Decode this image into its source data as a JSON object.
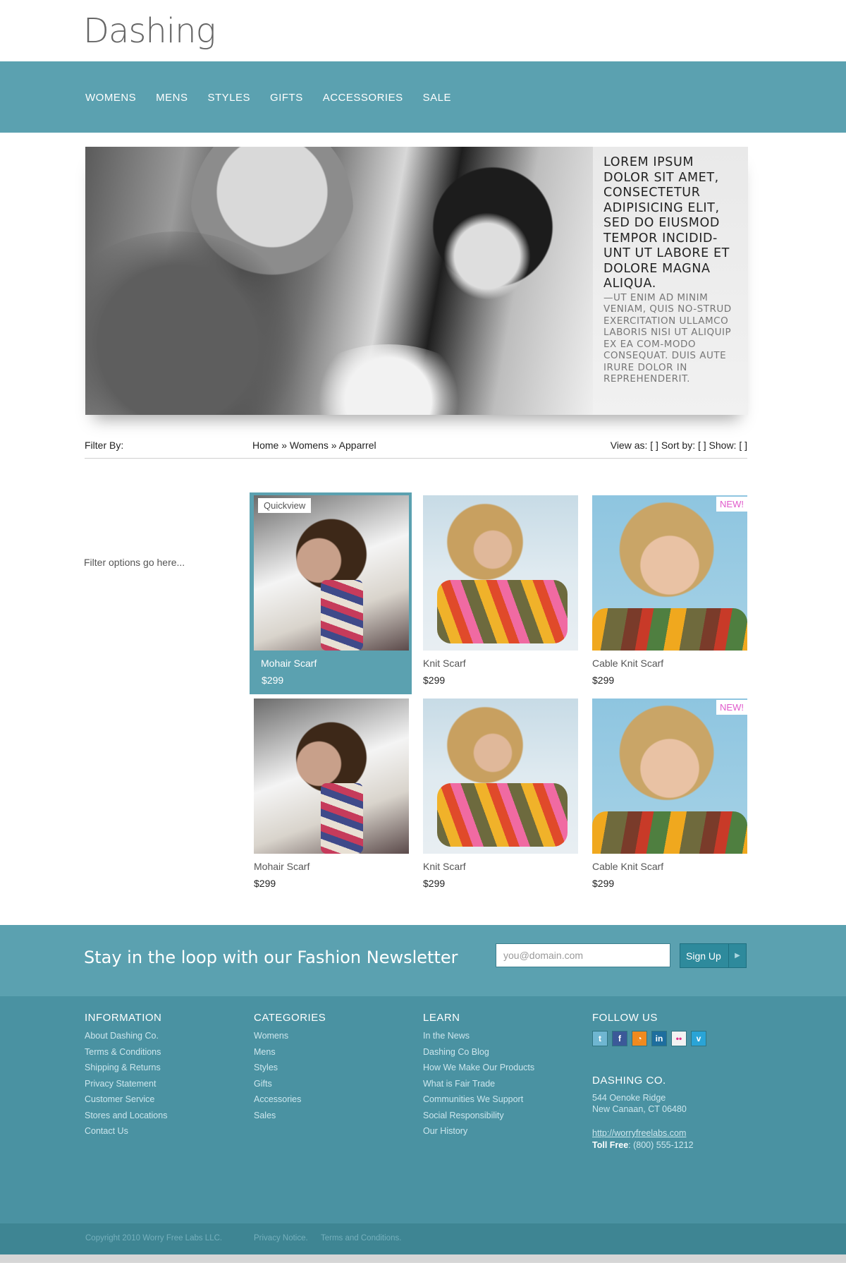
{
  "brand": {
    "logo": "Dashing"
  },
  "nav": {
    "items": [
      {
        "label": "WOMENS"
      },
      {
        "label": "MENS"
      },
      {
        "label": "STYLES"
      },
      {
        "label": "GIFTS"
      },
      {
        "label": "ACCESSORIES"
      },
      {
        "label": "SALE"
      }
    ]
  },
  "hero": {
    "headline": "LOREM IPSUM DOLOR SIT AMET, CONSECTETUR ADIPISICING ELIT, SED DO EIUSMOD TEMPOR INCIDID-UNT UT LABORE ET DOLORE MAGNA ALIQUA.",
    "body": "—UT ENIM AD MINIM VENIAM, QUIS NO-STRUD EXERCITATION ULLAMCO LABORIS NISI UT ALIQUIP EX EA COM-MODO CONSEQUAT. DUIS AUTE IRURE DOLOR IN REPREHENDERIT."
  },
  "toolbar": {
    "filter_label": "Filter By:",
    "breadcrumb": "Home » Womens » Apparrel",
    "view_controls": "View as: [  ]  Sort by:  [  ]  Show: [  ]"
  },
  "filters": {
    "placeholder": "Filter options go here..."
  },
  "products": [
    {
      "name": "Mohair Scarf",
      "price": "$299",
      "badge": "Quickview"
    },
    {
      "name": "Knit Scarf",
      "price": "$299"
    },
    {
      "name": "Cable Knit Scarf",
      "price": "$299",
      "badge": "NEW!"
    },
    {
      "name": "Mohair Scarf",
      "price": "$299"
    },
    {
      "name": "Knit Scarf",
      "price": "$299"
    },
    {
      "name": "Cable Knit Scarf",
      "price": "$299",
      "badge": "NEW!"
    }
  ],
  "newsletter": {
    "title": "Stay in the loop with our Fashion Newsletter",
    "placeholder": "you@domain.com",
    "button_label": "Sign Up",
    "button_arrow": "▶"
  },
  "footer": {
    "information": {
      "heading": "INFORMATION",
      "links": [
        "About Dashing Co.",
        "Terms & Conditions",
        "Shipping & Returns",
        "Privacy Statement",
        "Customer Service",
        "Stores and Locations",
        "Contact Us"
      ]
    },
    "categories": {
      "heading": "CATEGORIES",
      "links": [
        "Womens",
        "Mens",
        "Styles",
        "Gifts",
        "Accessories",
        "Sales"
      ]
    },
    "learn": {
      "heading": "LEARN",
      "links": [
        "In the News",
        "Dashing Co Blog",
        "How We Make Our Products",
        "What is Fair Trade",
        "Communities We Support",
        "Social Responsibility",
        "Our History"
      ]
    },
    "follow": {
      "heading": "FOLLOW US",
      "icons": [
        {
          "name": "twitter-icon",
          "glyph": "t",
          "color": "#6fb6d1"
        },
        {
          "name": "facebook-icon",
          "glyph": "f",
          "color": "#3b5998"
        },
        {
          "name": "rss-icon",
          "glyph": "◔",
          "color": "#f08a1e"
        },
        {
          "name": "linkedin-icon",
          "glyph": "in",
          "color": "#1e6e9e"
        },
        {
          "name": "flickr-icon",
          "glyph": "••",
          "color": "#f2f2f2"
        },
        {
          "name": "vimeo-icon",
          "glyph": "v",
          "color": "#2aa4d6"
        }
      ]
    },
    "company": {
      "heading": "DASHING CO.",
      "address_line1": "544 Oenoke Ridge",
      "address_line2": "New Canaan, CT 06480",
      "website": "http://worryfreelabs.com",
      "toll_label": "Toll Free",
      "toll_number": ": (800) 555-1212"
    }
  },
  "bottom": {
    "copyright": "Copyright 2010 Worry Free Labs LLC.",
    "privacy": "Privacy Notice.",
    "terms": "Terms and Conditions."
  }
}
